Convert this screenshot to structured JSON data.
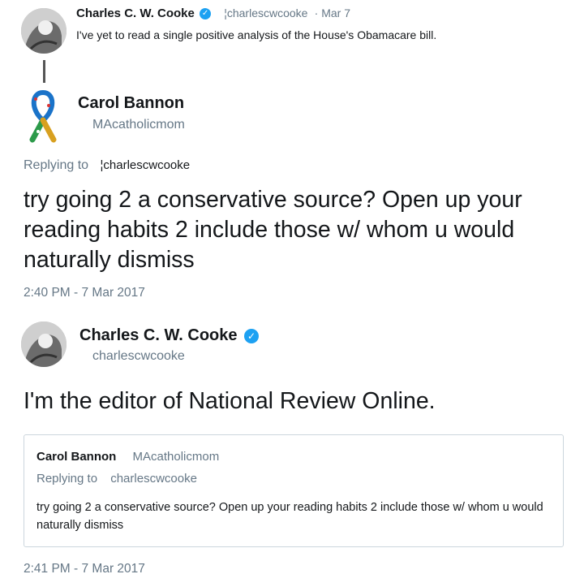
{
  "tweet1": {
    "name": "Charles C. W. Cooke",
    "handle": "¦charlescwcooke",
    "date": "· Mar 7",
    "text": "I've yet to read a single positive analysis of the House's Obamacare bill."
  },
  "reply": {
    "name": "Carol Bannon",
    "handle": "MAcatholicmom",
    "replying_label": "Replying to",
    "replying_handle": "¦charlescwcooke",
    "text": "try going 2 a conservative source? Open up your reading habits 2 include those w/ whom u would naturally dismiss",
    "timestamp": "2:40 PM - 7 Mar 2017"
  },
  "response": {
    "name": "Charles C. W. Cooke",
    "handle": "charlescwcooke",
    "text": "I'm the editor of National Review Online.",
    "timestamp": "2:41 PM - 7 Mar 2017",
    "quote": {
      "name": "Carol Bannon",
      "handle": "MAcatholicmom",
      "replying_label": "Replying to",
      "replying_handle": "charlescwcooke",
      "text": "try going 2 a conservative source? Open up your reading habits 2 include those w/ whom u would naturally dismiss"
    }
  },
  "icons": {
    "verified": "verified-badge-icon",
    "ribbon": "awareness-ribbon-icon"
  },
  "colors": {
    "verified": "#1da1f2",
    "muted": "#657786",
    "text": "#14171a"
  }
}
